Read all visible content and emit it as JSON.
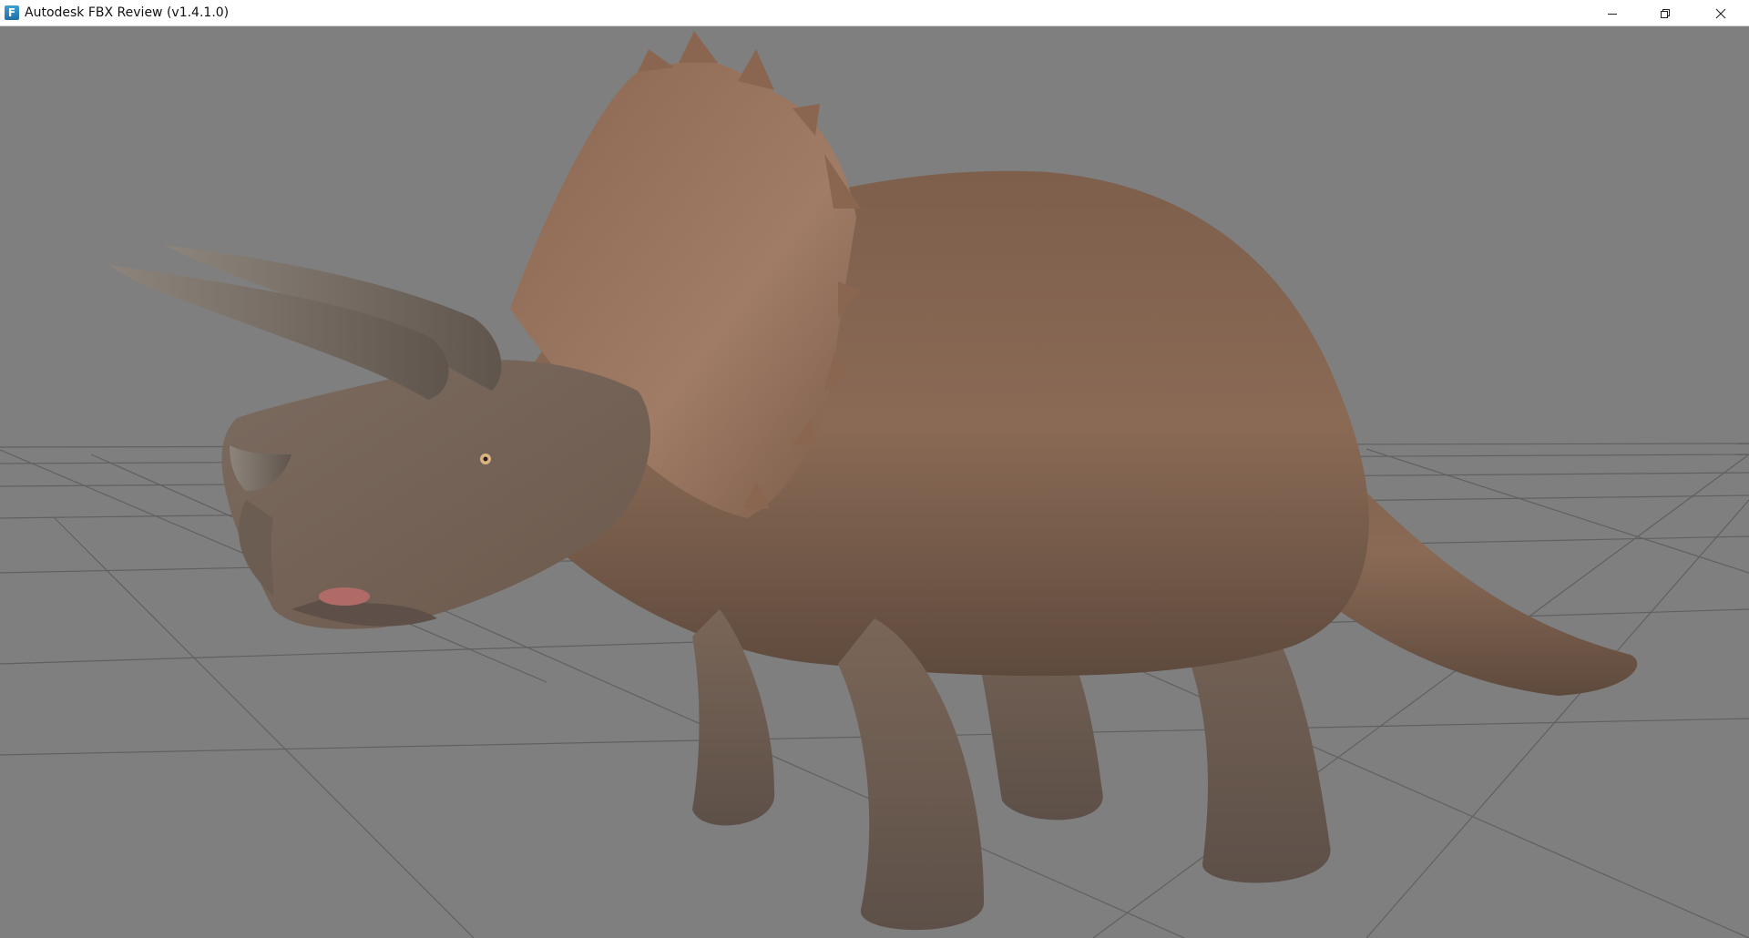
{
  "window": {
    "title": "Autodesk FBX Review (v1.4.1.0)",
    "app_icon_glyph": "F",
    "app_icon_name": "fbx-review-app-icon",
    "controls": {
      "minimize_icon": "minimize-icon",
      "restore_icon": "restore-icon",
      "close_icon": "close-icon"
    }
  },
  "viewport": {
    "background_color": "#7f7f7f",
    "grid_color": "#5e5e5e",
    "model": "triceratops",
    "model_skin_color": "#8a6a55"
  }
}
